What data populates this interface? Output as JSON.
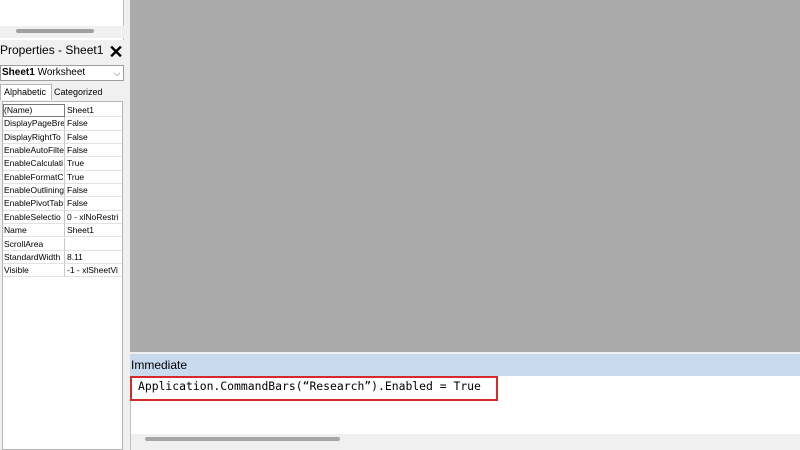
{
  "properties_window": {
    "title": "Properties - Sheet1",
    "close_glyph": "✕",
    "object_selector": {
      "name": "Sheet1",
      "type": "Worksheet",
      "arrow": "⌵"
    },
    "tabs": [
      "Alphabetic",
      "Categorized"
    ],
    "rows": [
      {
        "name": "(Name)",
        "value": "Sheet1"
      },
      {
        "name": "DisplayPageBre",
        "value": "False"
      },
      {
        "name": "DisplayRightTo",
        "value": "False"
      },
      {
        "name": "EnableAutoFilte",
        "value": "False"
      },
      {
        "name": "EnableCalculati",
        "value": "True"
      },
      {
        "name": "EnableFormatC",
        "value": "True"
      },
      {
        "name": "EnableOutlining",
        "value": "False"
      },
      {
        "name": "EnablePivotTab",
        "value": "False"
      },
      {
        "name": "EnableSelectio",
        "value": "0 - xlNoRestri"
      },
      {
        "name": "Name",
        "value": "Sheet1"
      },
      {
        "name": "ScrollArea",
        "value": ""
      },
      {
        "name": "StandardWidth",
        "value": "8.11"
      },
      {
        "name": "Visible",
        "value": "-1 - xlSheetVi"
      }
    ]
  },
  "immediate_window": {
    "title": "Immediate",
    "code_line": "Application.CommandBars(“Research”).Enabled = True"
  },
  "colors": {
    "workspace_bg": "#aaaaaa",
    "immediate_header_bg": "#c9d9ee",
    "highlight_border": "#d42a2a"
  }
}
